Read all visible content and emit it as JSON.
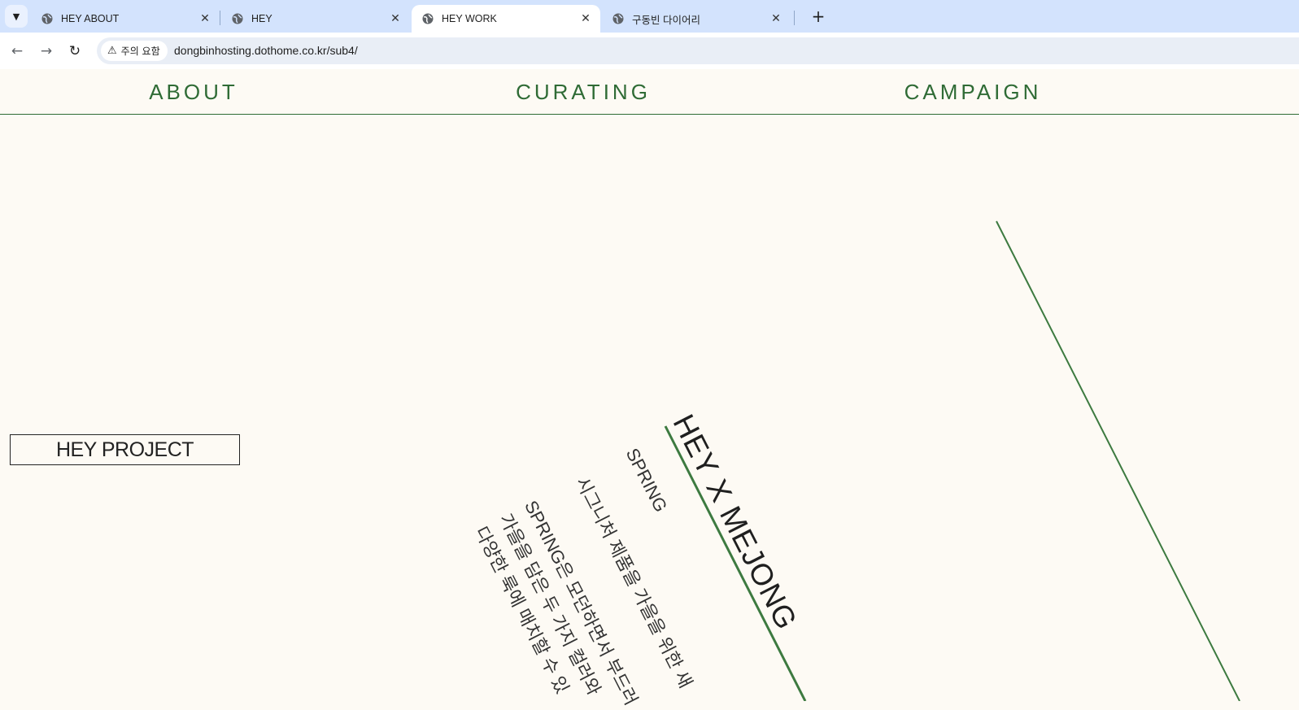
{
  "browser": {
    "tabs": [
      {
        "title": "HEY ABOUT",
        "active": false
      },
      {
        "title": "HEY",
        "active": false
      },
      {
        "title": "HEY WORK",
        "active": true
      },
      {
        "title": "구동빈 다이어리",
        "active": false
      }
    ],
    "security_label": "주의 요함",
    "url": "dongbinhosting.dothome.co.kr/sub4/"
  },
  "site": {
    "nav": [
      {
        "label": "ABOUT"
      },
      {
        "label": "CURATING"
      },
      {
        "label": "CAMPAIGN"
      }
    ],
    "project_button": "HEY PROJECT",
    "feature": {
      "title": "HEY X MEJONG",
      "subtitle": "SPRING",
      "caption": "시그니처 제품을 가을을 위한 새",
      "description_lines": [
        "SPRING은 모던하면서 부드러",
        "가을을 담은 두 가지 컬러와",
        "다양한 룩에 매치할 수 있"
      ]
    },
    "colors": {
      "accent_green": "#2f6b35",
      "background": "#fdfaf4",
      "tab_strip": "#d3e3fd"
    }
  }
}
